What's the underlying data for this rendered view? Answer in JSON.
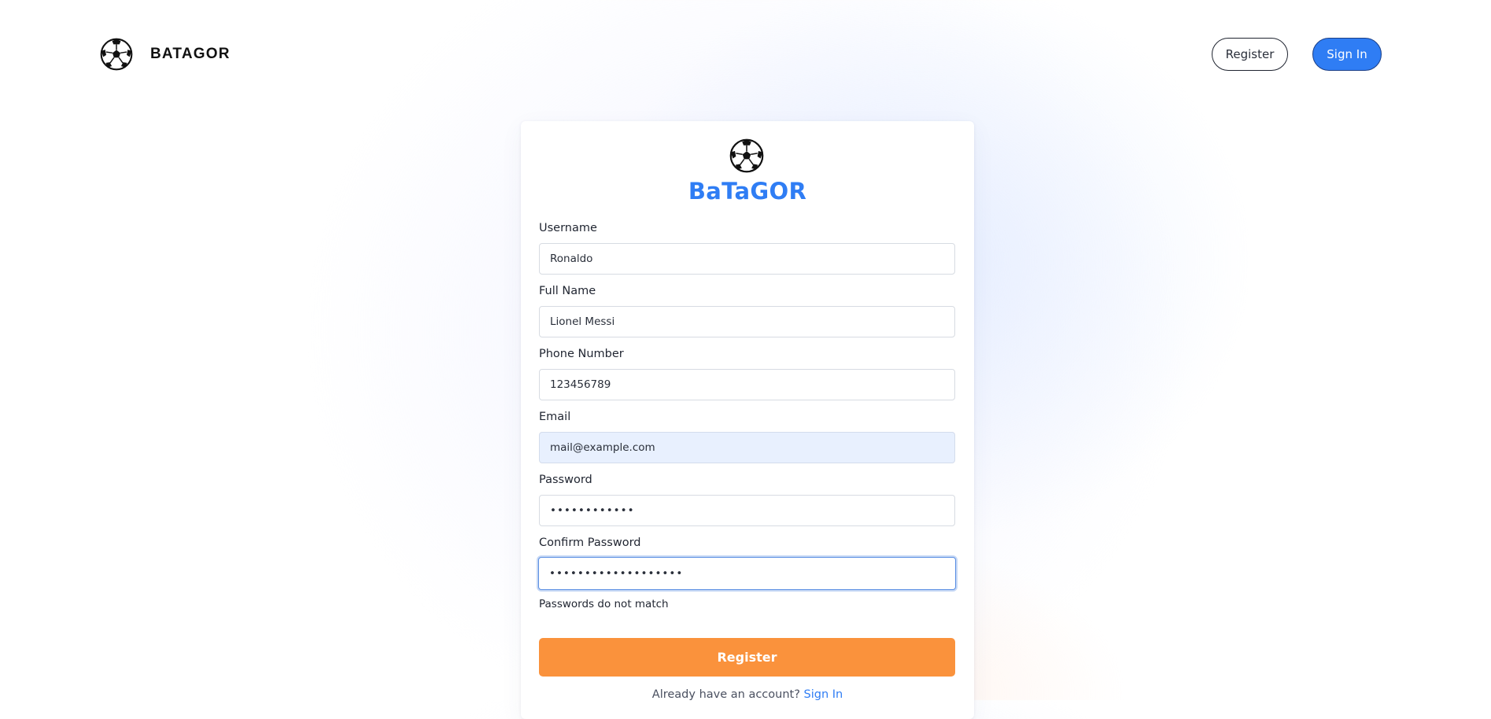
{
  "header": {
    "brand_name": "BATAGOR",
    "brand_icon": "soccer-ball-icon",
    "register_label": "Register",
    "signin_label": "Sign In"
  },
  "form": {
    "logo_icon": "soccer-ball-icon",
    "title": "BaTaGOR",
    "fields": {
      "username": {
        "label": "Username",
        "value": "Ronaldo"
      },
      "full_name": {
        "label": "Full Name",
        "value": "Lionel Messi"
      },
      "phone": {
        "label": "Phone Number",
        "value": "123456789"
      },
      "email": {
        "label": "Email",
        "value": "mail@example.com"
      },
      "password": {
        "label": "Password",
        "value": "••••••••••••"
      },
      "confirm_password": {
        "label": "Confirm Password",
        "value": "•••••••••••••••••••"
      }
    },
    "error_message": "Passwords do not match",
    "submit_label": "Register",
    "footer_prompt": "Already have an account?",
    "footer_link": "Sign In"
  },
  "colors": {
    "accent_blue": "#2f7df4",
    "submit_orange": "#fa923c",
    "autofill_bg": "#e8f0fe"
  }
}
